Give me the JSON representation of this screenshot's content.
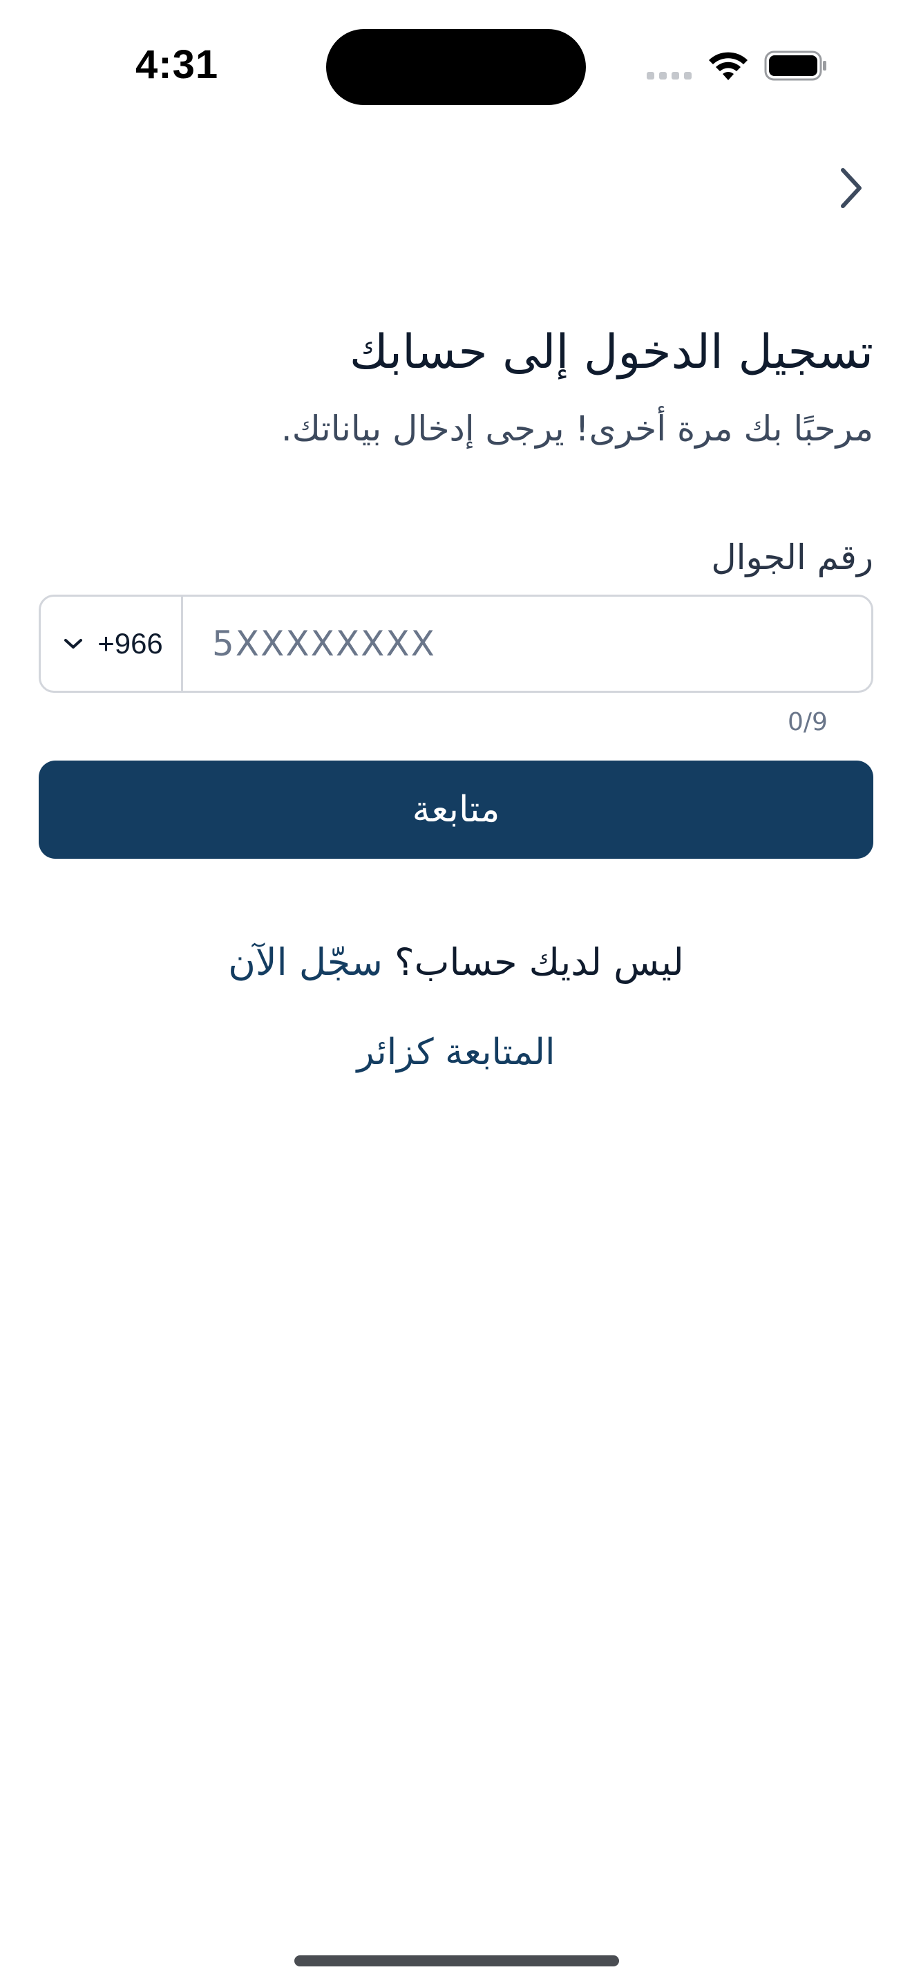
{
  "status_bar": {
    "time": "4:31"
  },
  "header": {
    "back_icon": "chevron-right-icon"
  },
  "login": {
    "title": "تسجيل الدخول إلى حسابك",
    "subtitle": "مرحبًا بك مرة أخرى! يرجى إدخال بياناتك.",
    "phone_label": "رقم الجوال",
    "country_code": "+966",
    "phone_value": "",
    "phone_placeholder": "5XXXXXXXX",
    "char_counter": "0/9",
    "continue_label": "متابعة",
    "no_account_text": "ليس لديك حساب؟",
    "register_label": "سجّل الآن",
    "guest_label": "المتابعة كزائر"
  },
  "colors": {
    "primary": "#143d61",
    "text": "#0f1b2d",
    "muted": "#6a768a",
    "border": "#d3d6dc"
  }
}
